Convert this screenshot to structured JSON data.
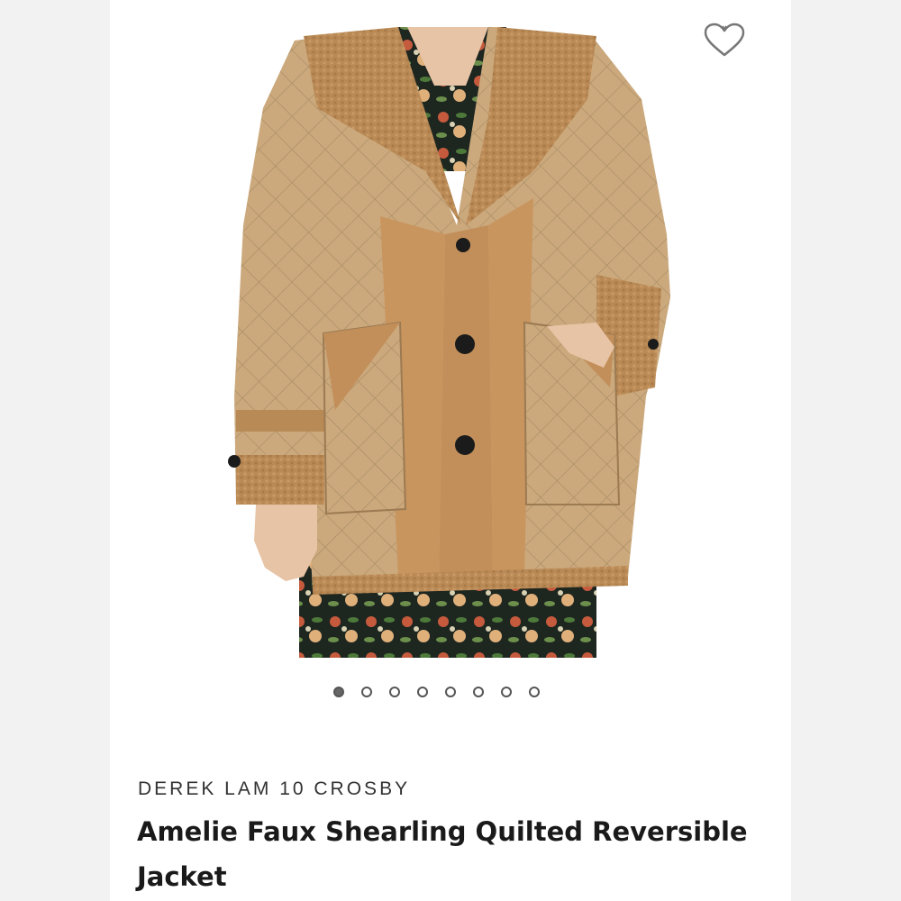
{
  "product": {
    "brand": "DEREK LAM 10 CROSBY",
    "name": "Amelie Faux Shearling Quilted Reversible Jacket"
  },
  "gallery": {
    "image_alt": "Quilted camel jacket with faux shearling collar worn over floral dress",
    "total_images": 8,
    "active_index": 0
  },
  "icons": {
    "favorite": "heart-outline-icon"
  },
  "colors": {
    "jacket_tan": "#c9a77b",
    "shearling_camel": "#b88a55",
    "button_black": "#1b1b1b",
    "dot_active": "#666666"
  }
}
